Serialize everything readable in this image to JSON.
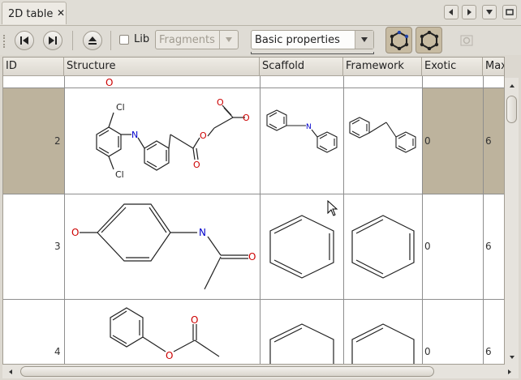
{
  "tab": {
    "label": "2D table",
    "close": "✕"
  },
  "toolbar": {
    "lib_label": "Lib",
    "fragments_value": "Fragments",
    "properties_value": "Basic properties"
  },
  "table": {
    "columns": [
      "ID",
      "Structure",
      "Scaffold",
      "Framework",
      "Exotic",
      "Max"
    ],
    "top_partial_label": "O",
    "rows": [
      {
        "id": "2",
        "exotic": "0",
        "max": "6",
        "selected": true,
        "structure_labels": {
          "cl_top": "Cl",
          "cl_bottom": "Cl",
          "n": "N",
          "o1": "O",
          "o2": "O",
          "o3": "O",
          "o4": "O"
        },
        "scaffold_labels": {
          "n": "N"
        }
      },
      {
        "id": "3",
        "exotic": "0",
        "max": "6",
        "selected": false,
        "structure_labels": {
          "o_left": "O",
          "n": "N",
          "o_right": "O"
        }
      },
      {
        "id": "4",
        "exotic": "0",
        "max": "6",
        "selected": false,
        "structure_labels": {
          "o_ester": "O",
          "o_carbonyl": "O"
        }
      }
    ]
  },
  "colors": {
    "selection": "#bdb39d",
    "heteroatom": "#cc0000",
    "nitrogen": "#0000cc",
    "toggle": "#c7bba2"
  }
}
